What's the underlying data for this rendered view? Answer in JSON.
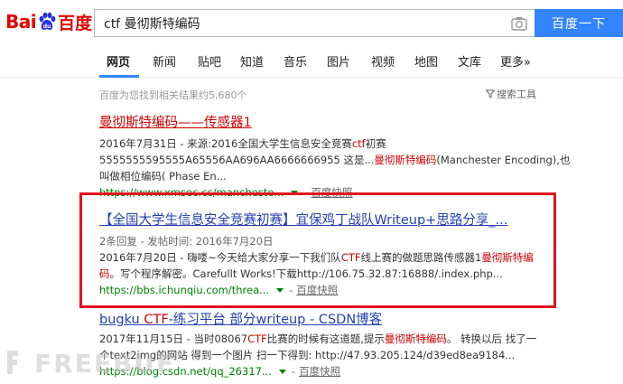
{
  "header": {
    "logo_bai": "Bai",
    "logo_cn": "百度",
    "search_value": "ctf 曼彻斯特编码",
    "search_button": "百度一下"
  },
  "tabs": [
    {
      "label": "网页",
      "active": true
    },
    {
      "label": "新闻"
    },
    {
      "label": "贴吧"
    },
    {
      "label": "知道"
    },
    {
      "label": "音乐"
    },
    {
      "label": "图片"
    },
    {
      "label": "视频"
    },
    {
      "label": "地图"
    },
    {
      "label": "文库"
    },
    {
      "label": "更多»"
    }
  ],
  "count_text": "百度为您找到相关结果约5,680个",
  "search_tools": "搜索工具",
  "results": [
    {
      "title": "曼彻斯特编码——传感器1",
      "line1_a": "2016年7月31日 - 来源:2016全国大学生信息安全竞赛",
      "line1_hl": "ctf",
      "line1_b": "初赛",
      "line2_a": "5555555595555A65556AA696AA6666666955 这是...",
      "line2_hl": "曼彻斯特编码",
      "line2_b": "(Manchester Encoding),也",
      "line3": "叫做相位编码( Phase En...",
      "url": "https://www.xmsec.cc/mancheste...",
      "snapshot": "百度快照"
    },
    {
      "title": "【全国大学生信息安全竞赛初赛】宜保鸡丁战队Writeup+思路分享_...",
      "meta": "2条回复 - 发帖时间: 2016年7月20日",
      "line1_a": "2016年7月20日 - 嗨喽~今天给大家分享一下我们队",
      "line1_hl": "CTF",
      "line1_b": "线上赛的做题思路传感器1",
      "line1_hl2": "曼彻斯特编",
      "line2_hl": "码",
      "line2_b": "。写个程序解密。Carefullt Works!下载http://106.75.32.87:16888/.index.php...",
      "url": "https://bbs.ichunqiu.com/threa...",
      "snapshot": "百度快照"
    },
    {
      "title_a": "bugku ",
      "title_hl": "CTF",
      "title_b": "-练习平台 部分writeup - CSDN博客",
      "line1_a": "2017年11月15日 - 当时08067",
      "line1_hl": "CTF",
      "line1_b": "比赛的时候有这道题,提示",
      "line1_hl2": "曼彻斯特编码",
      "line1_c": "。 转换以后 找了一",
      "line2": "个text2img的网站 得到一个图片 扫一下得到: http://47.93.205.124/d39ed8ea9184...",
      "url": "https://blog.csdn.net/qq_26317...",
      "snapshot": "百度快照"
    }
  ],
  "watermark": "FREEBUF",
  "colors": {
    "brand_red": "#e10602",
    "search_blue": "#3385ff",
    "link_blue": "#2440b3",
    "url_green": "#008000",
    "highlight_red": "#c00",
    "box_red": "#e3121e"
  }
}
